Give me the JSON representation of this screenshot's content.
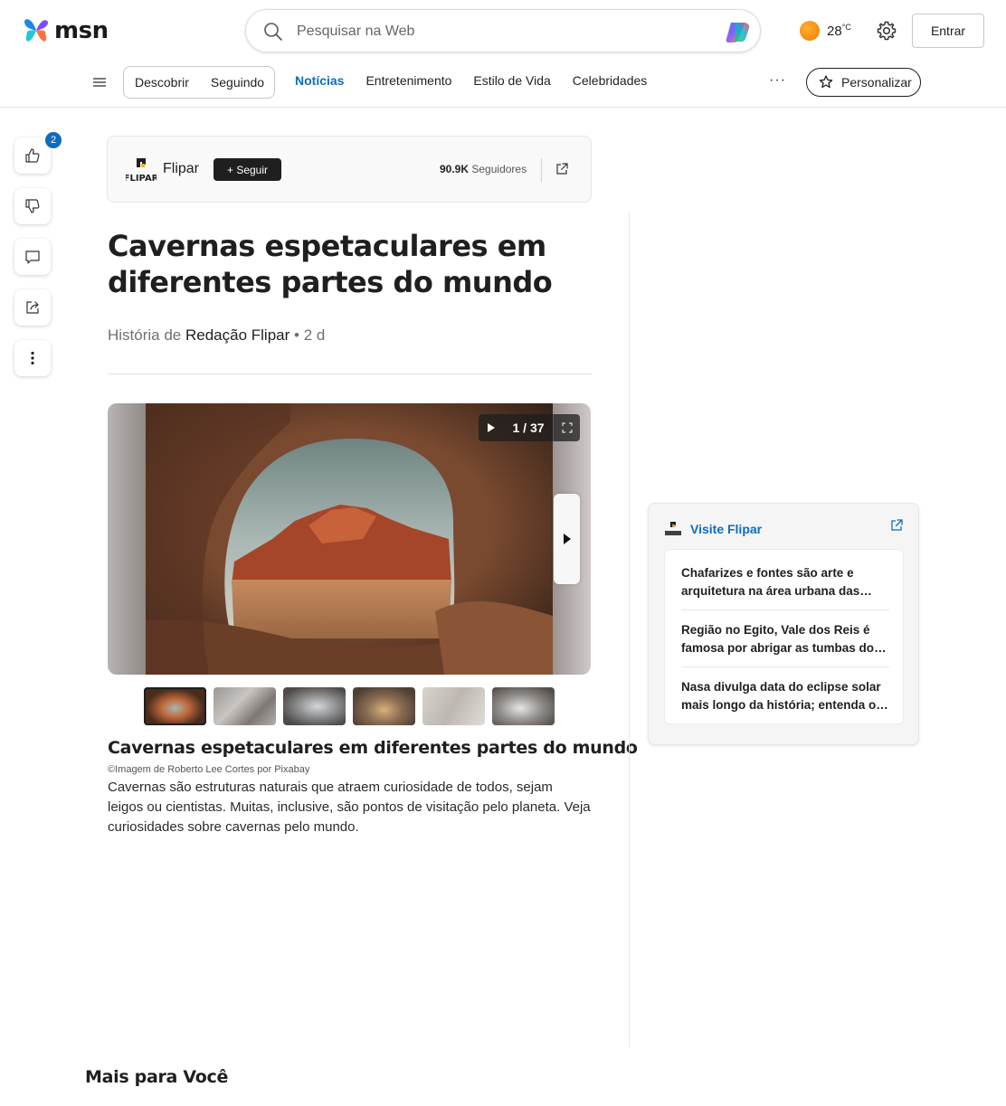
{
  "header": {
    "logo_text": "msn",
    "search_placeholder": "Pesquisar na Web",
    "temperature": "28",
    "temperature_unit": "°C",
    "signin_label": "Entrar"
  },
  "nav": {
    "pills": [
      "Descobrir",
      "Seguindo"
    ],
    "links": [
      {
        "label": "Notícias",
        "active": true
      },
      {
        "label": "Entretenimento",
        "active": false
      },
      {
        "label": "Estilo de Vida",
        "active": false
      },
      {
        "label": "Celebridades",
        "active": false
      }
    ],
    "more_label": "···",
    "personalize_label": "Personalizar"
  },
  "side_actions": {
    "like_count_badge": "2",
    "icons": [
      "thumbs-up-icon",
      "thumbs-down-icon",
      "comment-icon",
      "share-icon",
      "more-vertical-icon"
    ]
  },
  "publisher": {
    "logo_text": "FLIPAR",
    "name": "Flipar",
    "follow_label": "+ Seguir",
    "followers_count": "90.9K",
    "followers_label": "Seguidores"
  },
  "article": {
    "title": "Cavernas espetaculares em diferentes partes do mundo",
    "byline_prefix": "História de",
    "author": "Redação Flipar",
    "age": "• 2 d",
    "gallery": {
      "counter": "1 / 37",
      "thumb_count": 6,
      "active_thumb": 0
    },
    "caption_title": "Cavernas espetaculares em diferentes partes do mundo",
    "credit": "©Imagem de Roberto Lee Cortes por Pixabay",
    "caption_body": "Cavernas são estruturas naturais que atraem curiosidade de todos, sejam leigos ou cientistas. Muitas, inclusive, são pontos de visitação pelo planeta. Veja curiosidades sobre cavernas pelo mundo."
  },
  "related_card": {
    "title": "Visite Flipar",
    "items": [
      "Chafarizes e fontes são arte e arquitetura na área urbana das cidades",
      "Região no Egito, Vale dos Reis é famosa por abrigar as tumbas dos faraós",
      "Nasa divulga data do eclipse solar mais longo da história; entenda o fenômeno"
    ]
  },
  "more_section_title": "Mais para Você",
  "colors": {
    "accent": "#0f6cbd",
    "text": "#1f1f1f",
    "follow_button": "#1f1f1f"
  }
}
